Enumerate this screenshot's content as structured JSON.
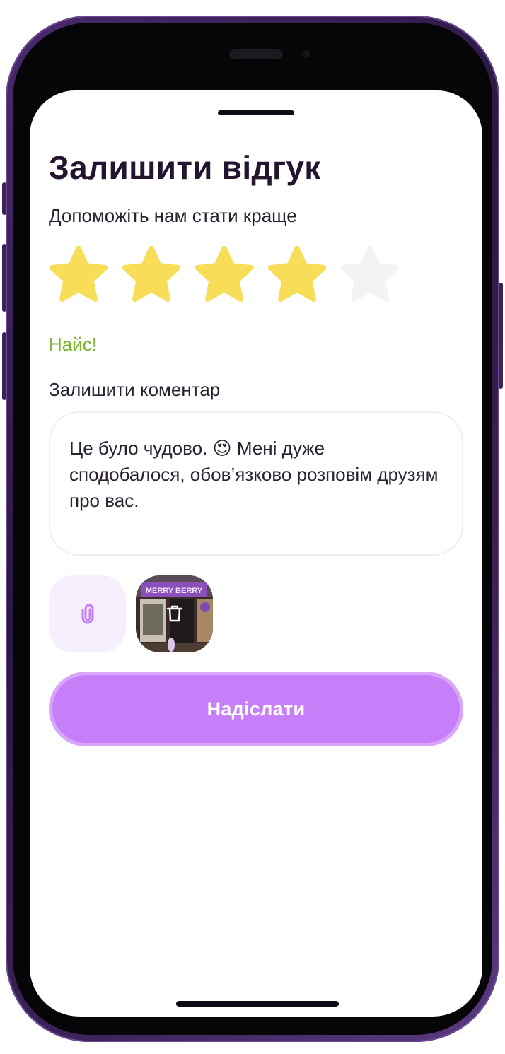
{
  "sheet": {
    "title": "Залишити відгук",
    "subtitle": "Допоможіть нам стати краще",
    "rating": {
      "value": 4,
      "max": 5,
      "label": "Найс!"
    },
    "comment": {
      "label": "Залишити коментар",
      "value": "Це було чудово. 😍 Мені дуже сподобалося, обов’язково розповім друзям про вас."
    },
    "attachments": {
      "attach_icon": "paperclip-icon",
      "photo_sign": "MERRY BERRY",
      "remove_icon": "trash-icon"
    },
    "submit_label": "Надіслати"
  },
  "colors": {
    "star_filled": "#f8dd58",
    "star_empty": "#f2f3f5",
    "rating_text": "#7ab52a",
    "accent": "#c67ff9",
    "title": "#23152f"
  }
}
